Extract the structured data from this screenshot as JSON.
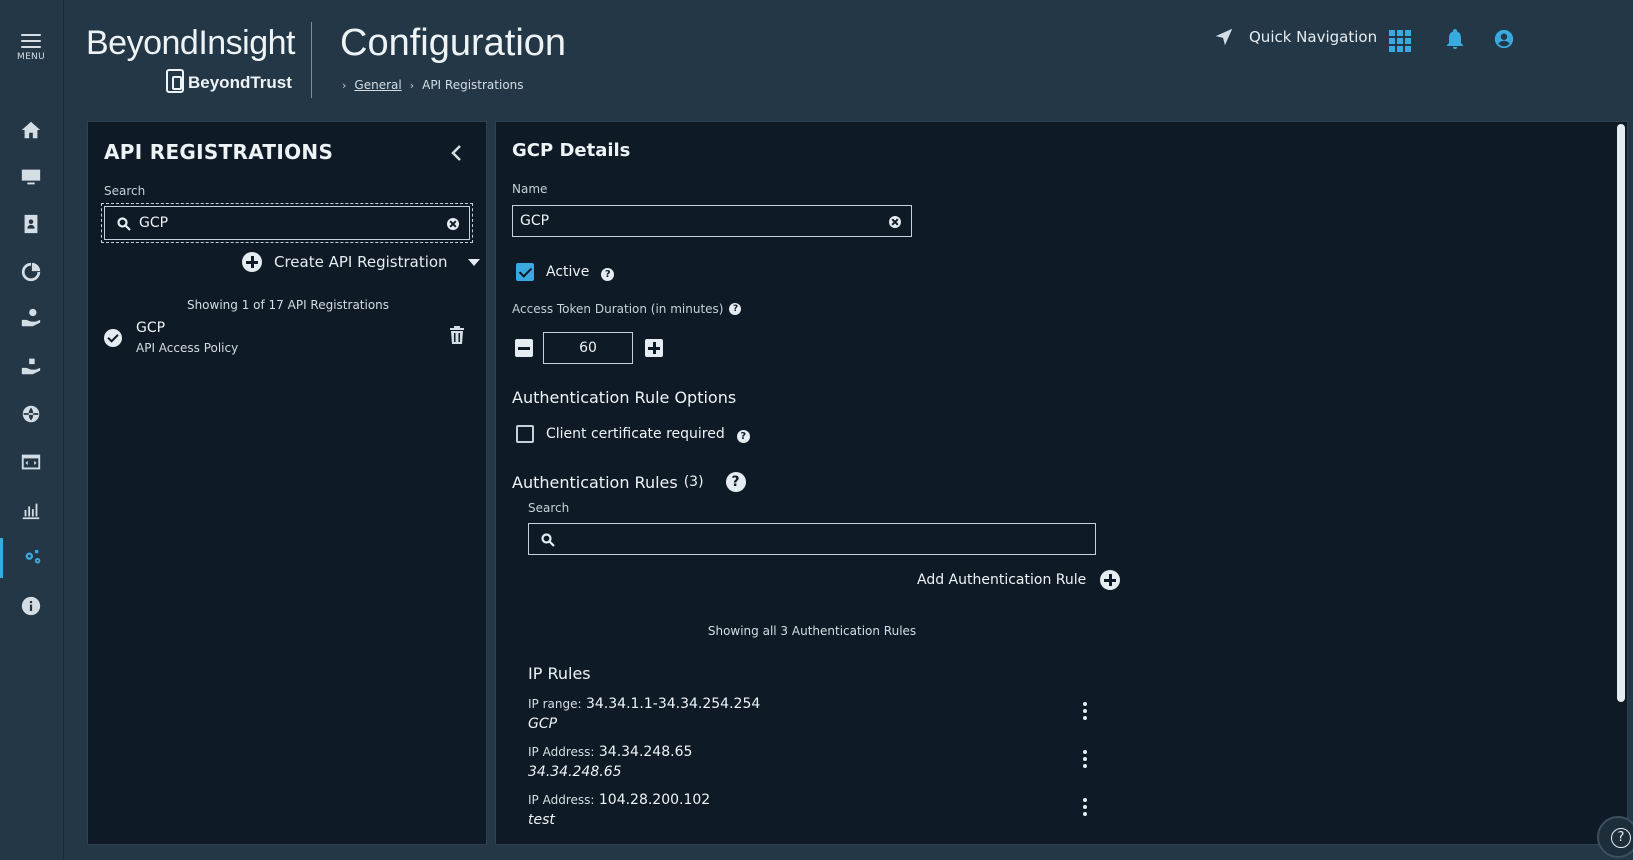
{
  "rail": {
    "menu_label": "MENU",
    "items": [
      {
        "icon": "home-icon"
      },
      {
        "icon": "monitor-icon"
      },
      {
        "icon": "address-book-icon"
      },
      {
        "icon": "analytics-icon"
      },
      {
        "icon": "hand-gear-icon"
      },
      {
        "icon": "hand-box-icon"
      },
      {
        "icon": "globe-network-icon"
      },
      {
        "icon": "browser-code-icon"
      },
      {
        "icon": "reports-chart-icon"
      },
      {
        "icon": "configuration-gears-icon",
        "active": true
      },
      {
        "icon": "info-icon"
      }
    ]
  },
  "header": {
    "product": "BeyondInsight",
    "company": "BeyondTrust",
    "title": "Configuration",
    "breadcrumb": {
      "link": "General",
      "current": "API Registrations"
    },
    "quick_nav": "Quick Navigation"
  },
  "left_panel": {
    "title": "API REGISTRATIONS",
    "search_label": "Search",
    "search_value": "GCP",
    "create_label": "Create API Registration",
    "showing": "Showing 1 of 17 API Registrations",
    "items": [
      {
        "name": "GCP",
        "sub": "API Access Policy"
      }
    ]
  },
  "details": {
    "title": "GCP Details",
    "name_label": "Name",
    "name_value": "GCP",
    "active_label": "Active",
    "active_checked": true,
    "duration_label": "Access Token Duration (in minutes)",
    "duration_value": "60",
    "auth_options_title": "Authentication Rule Options",
    "client_cert_label": "Client certificate required",
    "client_cert_checked": false,
    "auth_rules_title": "Authentication Rules",
    "auth_rules_count": "(3)",
    "auth_search_label": "Search",
    "auth_search_value": "",
    "add_rule_label": "Add Authentication Rule",
    "rules_showing": "Showing all 3 Authentication Rules",
    "ip_rules_title": "IP Rules",
    "ip_rules": [
      {
        "kind": "IP range:",
        "value": "34.34.1.1-34.34.254.254",
        "desc": "GCP"
      },
      {
        "kind": "IP Address:",
        "value": "34.34.248.65",
        "desc": "34.34.248.65"
      },
      {
        "kind": "IP Address:",
        "value": "104.28.200.102",
        "desc": "test"
      }
    ]
  },
  "colors": {
    "background": "#243746",
    "panel": "#0e1b26",
    "accent": "#3aa9e0"
  }
}
